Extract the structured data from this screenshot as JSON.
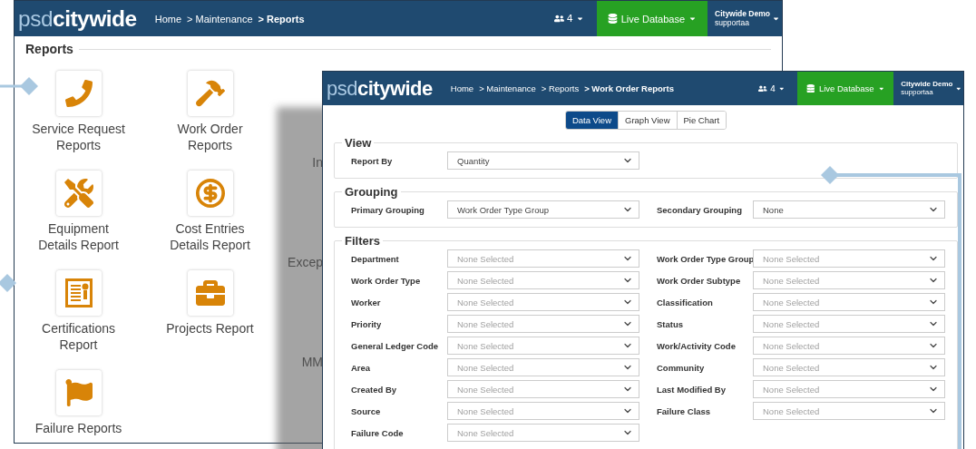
{
  "back_window": {
    "logo": {
      "light": "psd",
      "bold": "citywide"
    },
    "breadcrumb": [
      {
        "label": "Home",
        "current": false
      },
      {
        "label": "> Maintenance",
        "current": false
      },
      {
        "label": "> Reports",
        "current": true
      }
    ],
    "users_count": "4",
    "database": "Live Database",
    "user": {
      "org": "Citywide Demo",
      "name": "supportaa"
    },
    "section_title": "Reports",
    "reports": [
      {
        "label": "Service Request Reports",
        "kind": "phone"
      },
      {
        "label": "Work Order Reports",
        "kind": "hammer"
      },
      {
        "label": "Equipment Details Report",
        "kind": "tools"
      },
      {
        "label": "Cost Entries Details Report",
        "kind": "dollar"
      },
      {
        "label": "Certifications Report",
        "kind": "certificate"
      },
      {
        "label": "Projects Report",
        "kind": "briefcase"
      },
      {
        "label": "Failure Reports",
        "kind": "flag"
      }
    ],
    "hidden_reports": [
      "In",
      "Excep",
      "MM"
    ]
  },
  "front_window": {
    "logo": {
      "light": "psd",
      "bold": "citywide"
    },
    "breadcrumb": [
      {
        "label": "Home",
        "current": false
      },
      {
        "label": "> Maintenance",
        "current": false
      },
      {
        "label": "> Reports",
        "current": false
      },
      {
        "label": "> Work Order Reports",
        "current": true
      }
    ],
    "users_count": "4",
    "database": "Live Database",
    "user": {
      "org": "Citywide Demo",
      "name": "supportaa"
    },
    "view_tabs": [
      {
        "label": "Data View",
        "selected": true
      },
      {
        "label": "Graph View",
        "selected": false
      },
      {
        "label": "Pie Chart",
        "selected": false
      }
    ],
    "sections": [
      {
        "title": "View",
        "fields": [
          {
            "label": "Report By",
            "value": "Quantity"
          }
        ]
      },
      {
        "title": "Grouping",
        "fields": [
          {
            "label": "Primary Grouping",
            "value": "Work Order Type Group"
          },
          {
            "label": "Secondary Grouping",
            "value": "None"
          }
        ]
      },
      {
        "title": "Filters",
        "fields": [
          {
            "label": "Department",
            "placeholder": "None Selected"
          },
          {
            "label": "Work Order Type Group",
            "placeholder": "None Selected"
          },
          {
            "label": "Work Order Type",
            "placeholder": "None Selected"
          },
          {
            "label": "Work Order Subtype",
            "placeholder": "None Selected"
          },
          {
            "label": "Worker",
            "placeholder": "None Selected"
          },
          {
            "label": "Classification",
            "placeholder": "None Selected"
          },
          {
            "label": "Priority",
            "placeholder": "None Selected"
          },
          {
            "label": "Status",
            "placeholder": "None Selected"
          },
          {
            "label": "General Ledger Code",
            "placeholder": "None Selected"
          },
          {
            "label": "Work/Activity Code",
            "placeholder": "None Selected"
          },
          {
            "label": "Area",
            "placeholder": "None Selected"
          },
          {
            "label": "Community",
            "placeholder": "None Selected"
          },
          {
            "label": "Created By",
            "placeholder": "None Selected"
          },
          {
            "label": "Last Modified By",
            "placeholder": "None Selected"
          },
          {
            "label": "Source",
            "placeholder": "None Selected"
          },
          {
            "label": "Failure Class",
            "placeholder": "None Selected"
          },
          {
            "label": "Failure Code",
            "placeholder": "None Selected"
          }
        ]
      }
    ]
  }
}
